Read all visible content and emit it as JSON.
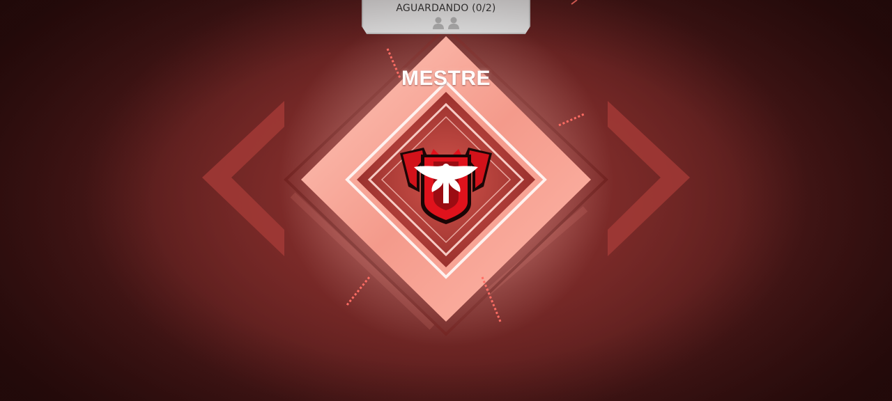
{
  "status": {
    "label": "AGUARDANDO (0/2)",
    "slots_icon": "two-players-icon"
  },
  "rank": {
    "title": "MESTRE",
    "emblem_icon": "eagle-rank-badge-icon"
  },
  "colors": {
    "background_dark": "#2a1212",
    "background_red": "#8a2e2c",
    "diamond_light": "#f4a597",
    "diamond_core": "#b23a36",
    "badge_red": "#d2121a",
    "panel_grey": "#dcdcdc"
  }
}
